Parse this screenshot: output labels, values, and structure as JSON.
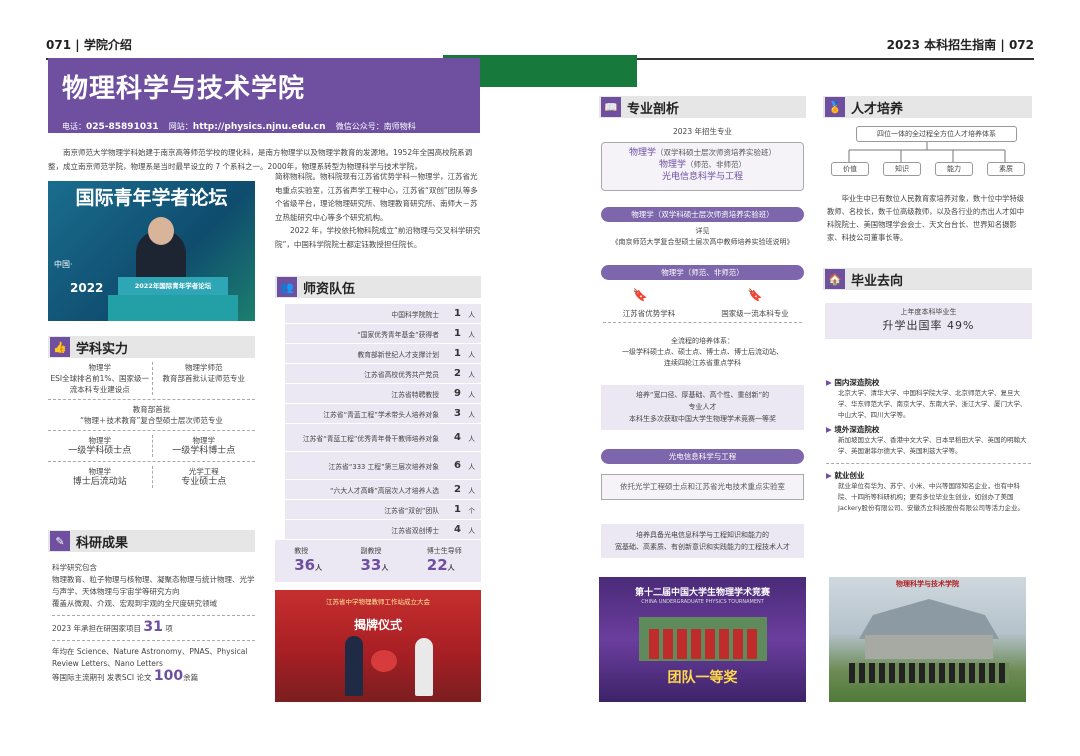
{
  "left_header": {
    "num": "071",
    "title": "学院介绍"
  },
  "right_header": {
    "title": "2023 本科招生指南",
    "num": "072"
  },
  "banner": {
    "title": "物理科学与技术学院",
    "tel_label": "电话：",
    "tel": "025-85891031",
    "web_label": "网站：",
    "web": "http://physics.njnu.edu.cn",
    "wechat": "微信公众号：南师物科"
  },
  "intro": "南京师范大学物理学科始建于南京高等师范学校的理化科，是南方物理学以及物理学教育的发源地。1952年全国高校院系调整，成立南京师范学院，物理系是当时最早设立的 7 个系科之一。2000年，物理系转型为物理科学与技术学院，",
  "intro2": "简称物科院。物科院现有江苏省优势学科—物理学，江苏省光电重点实验室，江苏省声学工程中心，江苏省“双创”团队等多个省级平台，理论物理研究所、物理教育研究所、南师大－苏立热能研究中心等多个研究机构。",
  "intro3": "2022 年，学校依托物科院成立“前沿物理与交叉科学研究院”，中国科学院院士都定钰教授担任院长。",
  "photo1": {
    "text1": "国际青年学者论坛",
    "text2": "2022年国际青年学者论坛",
    "text3": "中国·",
    "text4": "2022"
  },
  "xkhead": "学科实力",
  "xk": {
    "a1": "物理学",
    "a2": "ESI全球排名前1%、国家级一流本科专业建设点",
    "b1": "物理学师范",
    "b2": "教育部首批认证师范专业",
    "c1": "教育部首批",
    "c2": "“物理＋技术教育”复合型硕士层次师范专业",
    "d1": "物理学",
    "d2": "一级学科硕士点",
    "e1": "物理学",
    "e2": "一级学科博士点",
    "f1": "物理学",
    "f2": "博士后流动站",
    "g1": "光学工程",
    "g2": "专业硕士点"
  },
  "kyhead": "科研成果",
  "ky": {
    "l1": "科学研究包含",
    "l2": "物理教育、粒子物理与核物理、凝聚态物理与统计物理、光学与声学、天体物理与宇宙学等研究方向",
    "l3": "覆盖从微观、介观、宏观到宇观的全尺度研究领域",
    "l4a": "2023 年承担在研国家项目",
    "l4n": "31",
    "l4b": "项",
    "l5": "年均在 Science、Nature Astronomy、PNAS、Physical Review Letters、Nano Letters",
    "l6a": "等国际主流期刊 发表SCI 论文",
    "l6n": "100",
    "l6b": "余篇"
  },
  "szhead": "师资队伍",
  "faculty": [
    {
      "name": "中国科学院院士",
      "n": "1",
      "u": "人"
    },
    {
      "name": "“国家优秀青年基金”获得者",
      "n": "1",
      "u": "人"
    },
    {
      "name": "教育部新世纪人才支撑计划",
      "n": "1",
      "u": "人"
    },
    {
      "name": "江苏省高校优秀共产党员",
      "n": "2",
      "u": "人"
    },
    {
      "name": "江苏省特聘教授",
      "n": "9",
      "u": "人"
    },
    {
      "name": "江苏省“青蓝工程”学术带头人培养对象",
      "n": "3",
      "u": "人"
    },
    {
      "name": "江苏省“青蓝工程”优秀青年骨干教师培养对象",
      "n": "4",
      "u": "人"
    },
    {
      "name": "江苏省“333 工程”第三层次培养对象",
      "n": "6",
      "u": "人"
    },
    {
      "name": "“六大人才高峰”高层次人才培养人选",
      "n": "2",
      "u": "人"
    },
    {
      "name": "江苏省“双创”团队",
      "n": "1",
      "u": "个"
    },
    {
      "name": "江苏省双创博士",
      "n": "4",
      "u": "人"
    },
    {
      "name": "南师大“中青年领军人才”培养对象",
      "n": "7",
      "u": "人"
    }
  ],
  "stats": [
    {
      "label": "教授",
      "n": "36",
      "u": "人"
    },
    {
      "label": "副教授",
      "n": "33",
      "u": "人"
    },
    {
      "label": "博士生导师",
      "n": "22",
      "u": "人"
    }
  ],
  "photo2": {
    "text": "江苏省中学物理教师工作站成立大会",
    "text2": "揭牌仪式"
  },
  "zyhead": "专业剖析",
  "zy": {
    "year": "2023 年招生专业",
    "m1": "物理学",
    "m1s": "（双学科硕士层次师资培养实验班）",
    "m2": "物理学",
    "m2s": "（师范、非师范）",
    "m3": "光电信息科学与工程",
    "p1": "物理学（双学科硕士层次师资培养实验班）",
    "p1d1": "详见",
    "p1d2": "《南京师范大学复合型硕士层次高中教师培养实验班说明》",
    "p2": "物理学（师范、非师范）",
    "p2a": "江苏省优势学科",
    "p2b": "国家级一流本科专业",
    "p2c1": "全流程的培养体系：",
    "p2c2": "一级学科硕士点、硕士点、博士点、博士后流动站、",
    "p2c3": "连续四轮江苏省重点学科",
    "p2d1": "培养“宽口径、厚基础、高个性、重创新”的",
    "p2d2": "专业人才",
    "p2d3": "本科生多次获取中国大学生物理学术竞赛一等奖",
    "p3": "光电信息科学与工程",
    "p3a": "依托光学工程硕士点和江苏省光电技术重点实验室",
    "p3b": "培养具备光电信息科学与工程知识和能力的",
    "p3c": "宽基础、高素质、有创新意识和实践能力的工程技术人才"
  },
  "photo3": {
    "title": "第十二届中国大学生物理学术竞赛",
    "sub": "CHINA UNDERGRADUATE PHYSICS TOURNAMENT",
    "award": "团队一等奖"
  },
  "rchead": "人才培养",
  "rc": {
    "top": "四位一体的全过程全方位人才培养体系",
    "chips": [
      "价值",
      "知识",
      "能力",
      "素质"
    ],
    "text": "毕业生中已有数位人民教育家培养对象，数十位中学特级教师、名校长，数千位高级教师，以及各行业的杰出人才如中科院院士、美国物理学会会士、天文台台长、世界知名摄影家、科技公司董事长等。"
  },
  "byhead": "毕业去向",
  "by": {
    "label": "上年度本科毕业生",
    "rate": "升学出国率  49%",
    "g1": "国内深造院校",
    "g1t": "北京大学、清华大学、中国科学院大学、北京师范大学、复旦大学、华东师范大学、南京大学、东南大学、浙江大学、厦门大学、中山大学、四川大学等。",
    "g2": "境外深造院校",
    "g2t": "新加坡国立大学、香港中文大学、日本早稻田大学、英国的明翰大学、英国谢菲尔德大学、英国利兹大学等。",
    "g3": "就业创业",
    "g3t": "就业单位有华为、苏宁、小米、中兴等国际知名企业，也有中科院、十四所等科研机构；更有多位毕业生创业，如创办了美国Jackery股份有限公司、安徽杰立科技股份有限公司等活力企业。"
  },
  "photo4": {
    "text": "物理科学与技术学院"
  }
}
